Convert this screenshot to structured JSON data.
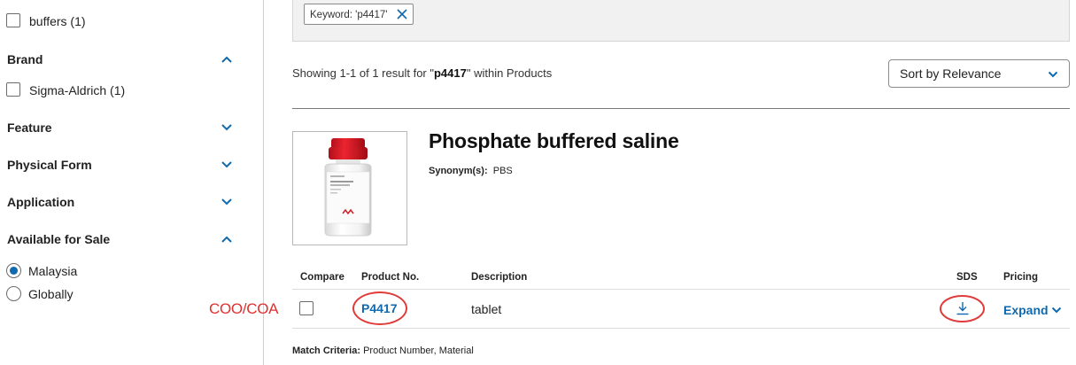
{
  "sidebar": {
    "buffers_label": "buffers (1)",
    "brand": {
      "heading": "Brand",
      "option": "Sigma-Aldrich (1)"
    },
    "feature": {
      "heading": "Feature"
    },
    "physical_form": {
      "heading": "Physical Form"
    },
    "application": {
      "heading": "Application"
    },
    "available_for_sale": {
      "heading": "Available for Sale",
      "options": [
        "Malaysia",
        "Globally"
      ],
      "selected": "Malaysia"
    }
  },
  "filter": {
    "chip_label": "Keyword: 'p4417'"
  },
  "results": {
    "prefix": "Showing 1-1 of 1 result for \"",
    "term": "p4417",
    "suffix": "\" within Products"
  },
  "sort": {
    "label": "Sort by Relevance"
  },
  "product": {
    "title": "Phosphate buffered saline",
    "synonyms_label": "Synonym(s):",
    "synonyms_value": "PBS",
    "table": {
      "headers": {
        "compare": "Compare",
        "product_no": "Product No.",
        "description": "Description",
        "sds": "SDS",
        "pricing": "Pricing"
      },
      "row": {
        "product_no": "P4417",
        "description": "tablet",
        "pricing": "Expand"
      }
    },
    "match_label": "Match Criteria:",
    "match_value": "Product Number, Material"
  },
  "annotation": {
    "text": "COO/COA",
    "color": "#e03030"
  },
  "colors": {
    "accent": "#0f69af",
    "annotation": "#e03030"
  },
  "icons": [
    "close-icon",
    "chevron-up-icon",
    "chevron-down-icon",
    "download-icon"
  ]
}
